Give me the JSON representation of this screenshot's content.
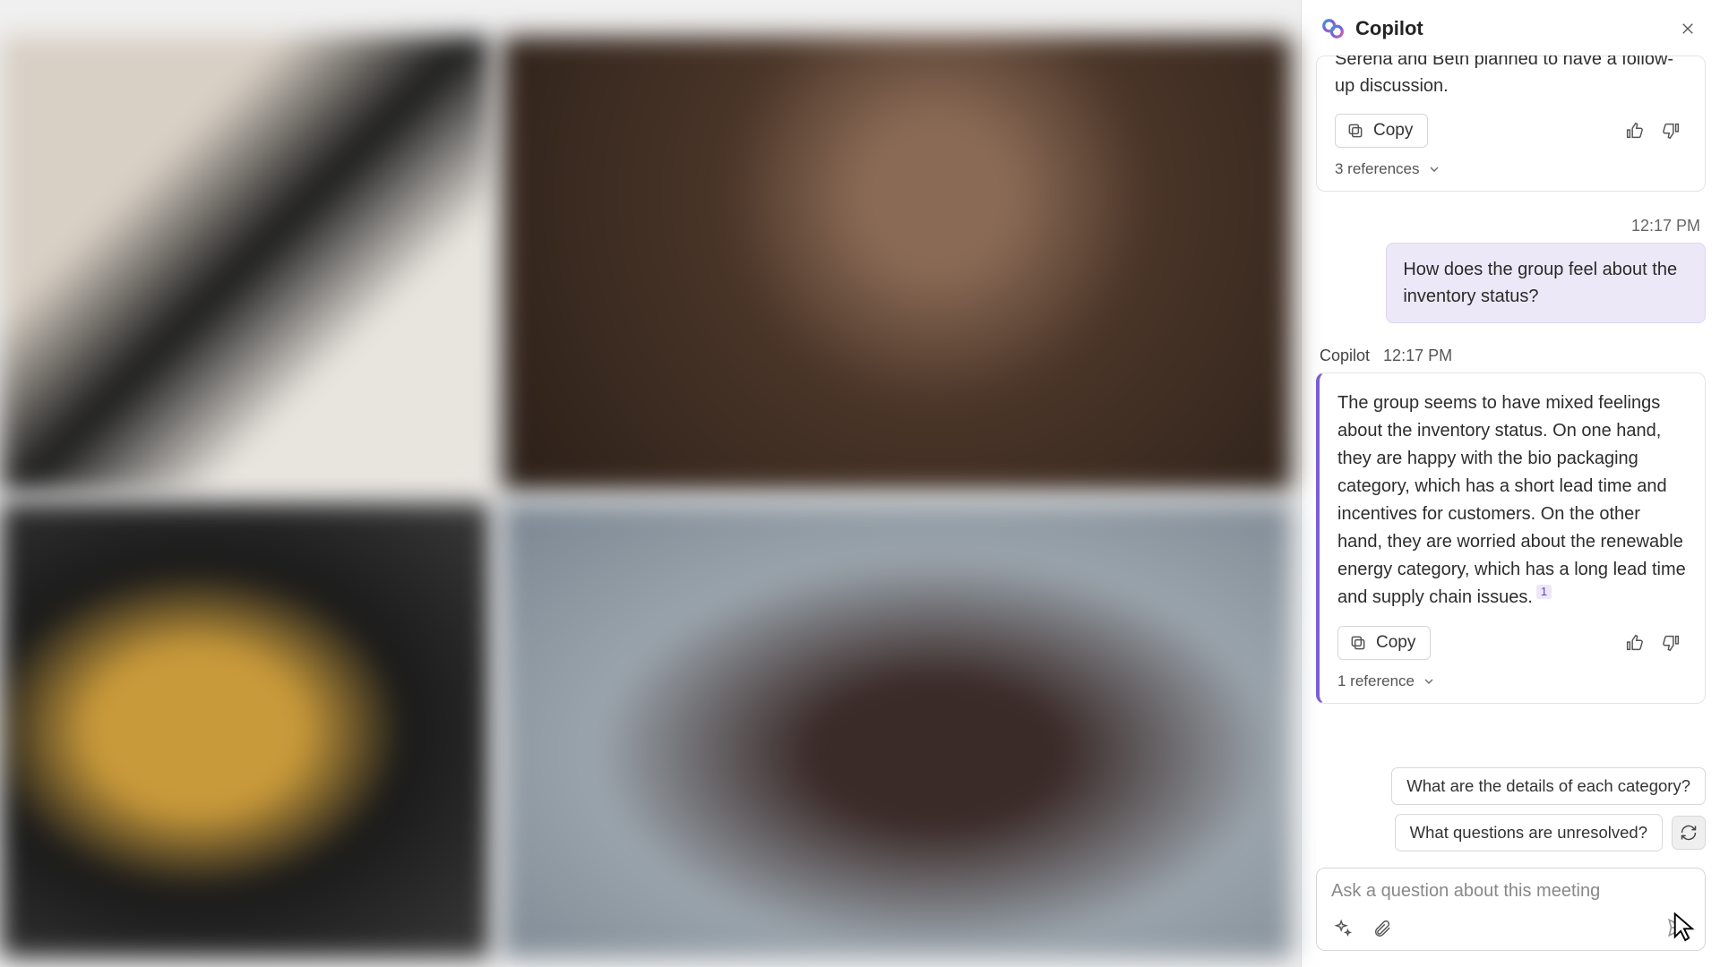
{
  "header": {
    "title": "Copilot"
  },
  "messages": {
    "partial_response": "Serena and Beth planned to have a follow-up discussion.",
    "copy_label": "Copy",
    "refs1": "3 references",
    "ts1": "12:17 PM",
    "user_question": "How does the group feel about the inventory status?",
    "sender_name": "Copilot",
    "sender_ts": "12:17 PM",
    "main_response": "The group seems to have mixed feelings about the inventory status. On one hand, they are happy with the bio packaging category, which has a short lead time and incentives for customers. On the other hand, they are worried about the renewable energy category, which has a long lead time and supply chain issues.",
    "citation": "1",
    "refs2": "1 reference"
  },
  "suggestions": {
    "s1": "What are the details of each category?",
    "s2": "What questions are unresolved?"
  },
  "input": {
    "placeholder": "Ask a question about this meeting"
  }
}
